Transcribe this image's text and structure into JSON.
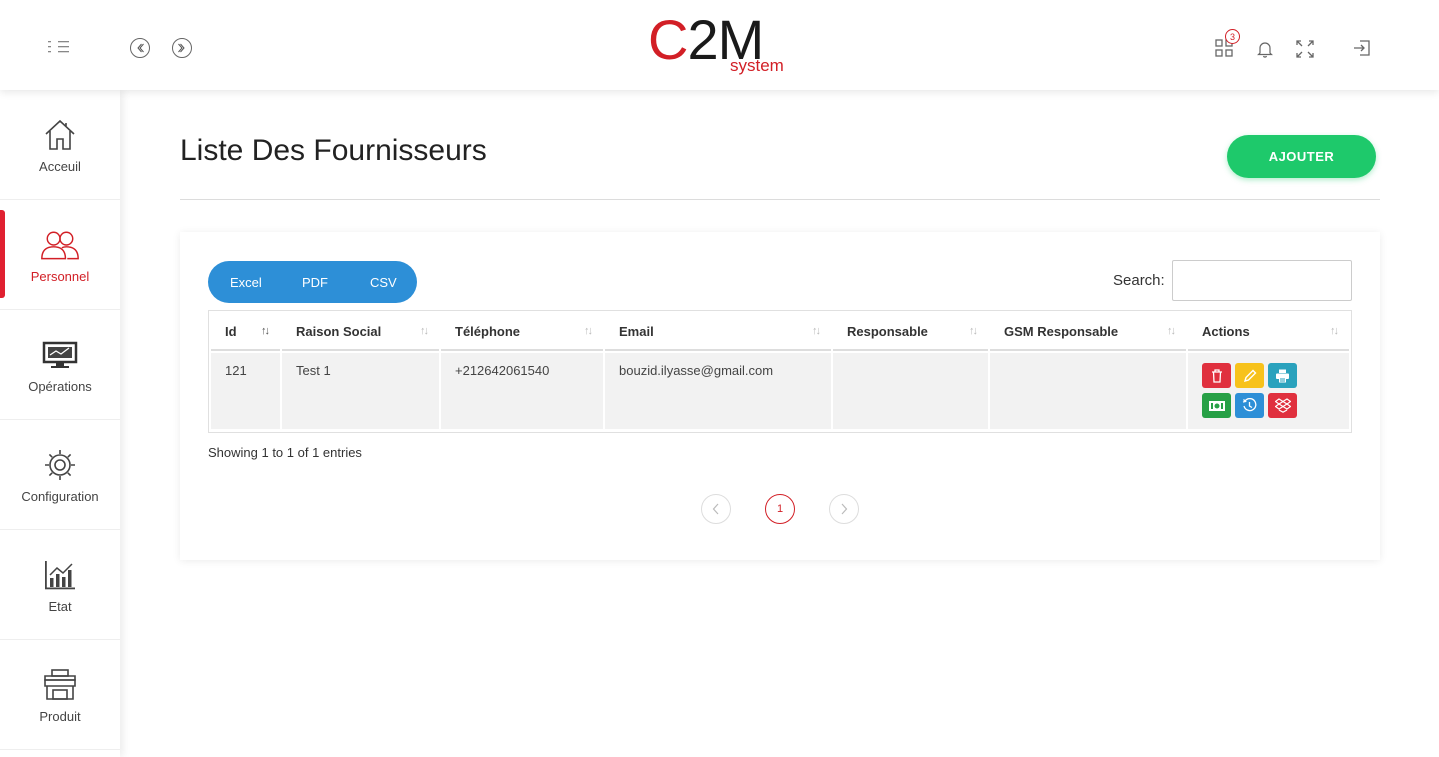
{
  "header": {
    "logo_main_c": "C",
    "logo_main_rest": "2M",
    "logo_sub": "system",
    "apps_badge": "3",
    "icons": [
      "menu-toggle-icon",
      "chevron-left-icon",
      "chevron-right-icon",
      "apps-grid-icon",
      "bell-icon",
      "fullscreen-icon",
      "logout-icon"
    ]
  },
  "sidebar": {
    "items": [
      {
        "label": "Acceuil",
        "icon": "home-icon"
      },
      {
        "label": "Personnel",
        "icon": "users-icon",
        "active": true
      },
      {
        "label": "Opérations",
        "icon": "monitor-icon"
      },
      {
        "label": "Configuration",
        "icon": "gear-icon"
      },
      {
        "label": "Etat",
        "icon": "bar-chart-icon"
      },
      {
        "label": "Produit",
        "icon": "shop-icon"
      }
    ]
  },
  "main": {
    "title": "Liste Des Fournisseurs",
    "add_label": "AJOUTER",
    "export": {
      "excel": "Excel",
      "pdf": "PDF",
      "csv": "CSV"
    },
    "search_label": "Search:",
    "search_value": "",
    "columns": [
      "Id",
      "Raison Social",
      "Téléphone",
      "Email",
      "Responsable",
      "GSM Responsable",
      "Actions"
    ],
    "rows": [
      {
        "id": "121",
        "raison": "Test 1",
        "tel": "+212642061540",
        "email": "bouzid.ilyasse@gmail.com",
        "responsable": "",
        "gsm": ""
      }
    ],
    "action_icons": [
      "trash-icon",
      "pencil-icon",
      "print-icon",
      "money-icon",
      "clock-icon",
      "dropbox-icon"
    ],
    "info": "Showing 1 to 1 of 1 entries",
    "pagination": {
      "prev": "‹",
      "current": "1",
      "next": "›"
    }
  },
  "colors": {
    "accent_red": "#d21f26",
    "green": "#1ec96b",
    "blue": "#2d8fd7"
  }
}
